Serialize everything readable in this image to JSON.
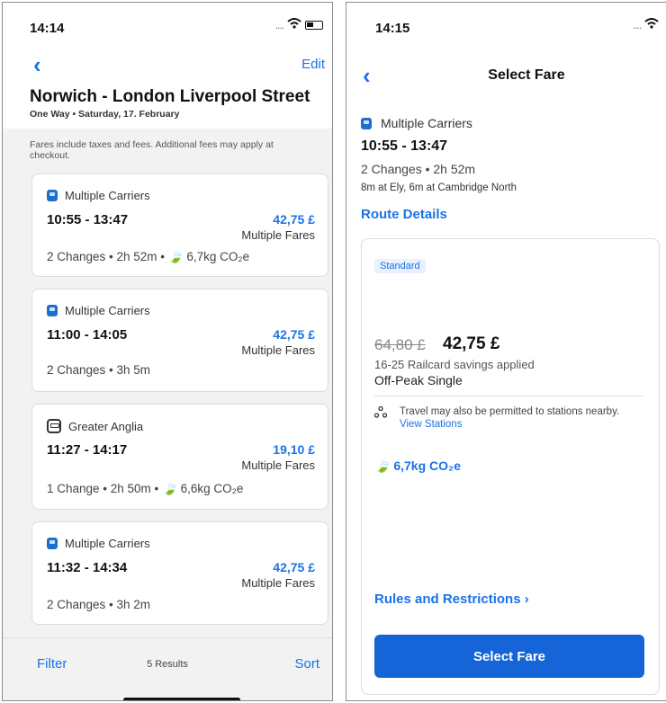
{
  "left": {
    "status_time": "14:14",
    "back_icon": "‹",
    "edit_label": "Edit",
    "route_title": "Norwich - London Liverpool Street",
    "route_subtitle": "One Way • Saturday, 17. February",
    "fare_note": "Fares include taxes and fees. Additional fees may apply at checkout.",
    "cards": [
      {
        "carrier": "Multiple Carriers",
        "carrier_icon": "train-icon",
        "times": "10:55 - 13:47",
        "price": "42,75 £",
        "fares": "Multiple Fares",
        "changes": "2 Changes  •  2h 52m  •  ",
        "co2": "6,7kg CO₂e"
      },
      {
        "carrier": "Multiple Carriers",
        "carrier_icon": "train-icon",
        "times": "11:00 - 14:05",
        "price": "42,75 £",
        "fares": "Multiple Fares",
        "changes": "2 Changes  •  3h 5m",
        "co2": ""
      },
      {
        "carrier": "Greater Anglia",
        "carrier_icon": "greater-anglia-icon",
        "times": "11:27 - 14:17",
        "price": "19,10 £",
        "fares": "Multiple Fares",
        "changes": "1 Change  •  2h 50m  •  ",
        "co2": "6,6kg CO₂e"
      },
      {
        "carrier": "Multiple Carriers",
        "carrier_icon": "train-icon",
        "times": "11:32 - 14:34",
        "price": "42,75 £",
        "fares": "Multiple Fares",
        "changes": "2 Changes  •  3h 2m",
        "co2": ""
      }
    ],
    "filter_label": "Filter",
    "results_count": "5 Results",
    "sort_label": "Sort"
  },
  "right": {
    "status_time": "14:15",
    "back_icon": "‹",
    "page_title": "Select Fare",
    "carrier": "Multiple Carriers",
    "times": "10:55 - 13:47",
    "changes": "2 Changes  •  2h 52m",
    "stops": "8m at Ely, 6m at Cambridge North",
    "route_details": "Route Details",
    "fare": {
      "badge": "Standard",
      "old_price": "64,80 £",
      "new_price": "42,75 £",
      "savings": "16-25 Railcard savings applied",
      "fare_type": "Off-Peak Single",
      "stations_text": "Travel may also be permitted to stations nearby.",
      "view_stations": "View Stations",
      "co2": "6,7kg CO₂e",
      "rules": "Rules and Restrictions",
      "rules_chevron": "›",
      "select_label": "Select Fare"
    }
  },
  "colors": {
    "accent": "#1a73e8",
    "button": "#1565d8",
    "badge_bg": "#e8f1fd",
    "list_bg": "#f2f2f2"
  }
}
